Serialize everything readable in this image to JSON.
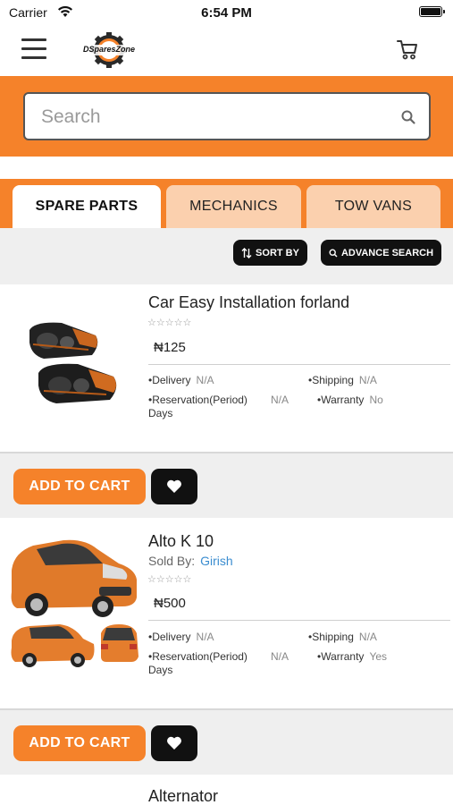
{
  "status_bar": {
    "carrier": "Carrier",
    "time": "6:54 PM"
  },
  "header": {
    "logo_text": "DSparesZone"
  },
  "search": {
    "placeholder": "Search"
  },
  "tabs": [
    {
      "label": "SPARE PARTS",
      "active": true
    },
    {
      "label": "MECHANICS",
      "active": false
    },
    {
      "label": "TOW VANS",
      "active": false
    }
  ],
  "toolbar": {
    "sort_label": "SORT BY",
    "advance_label": "ADVANCE SEARCH"
  },
  "products": [
    {
      "title": "Car Easy Installation forland",
      "sold_by_label": "",
      "seller": "",
      "rating_stars": "☆☆☆☆☆",
      "price": "₦125",
      "delivery_label": "•Delivery",
      "delivery_value": "N/A",
      "shipping_label": "•Shipping",
      "shipping_value": "N/A",
      "reservation_label": "•Reservation(Period)",
      "reservation_value": "N/A",
      "reservation_unit": "Days",
      "warranty_label": "•Warranty",
      "warranty_value": "No",
      "add_to_cart": "ADD TO CART"
    },
    {
      "title": "Alto K 10",
      "sold_by_label": "Sold By:",
      "seller": "Girish",
      "rating_stars": "☆☆☆☆☆",
      "price": "₦500",
      "delivery_label": "•Delivery",
      "delivery_value": "N/A",
      "shipping_label": "•Shipping",
      "shipping_value": "N/A",
      "reservation_label": "•Reservation(Period)",
      "reservation_value": "N/A",
      "reservation_unit": "Days",
      "warranty_label": "•Warranty",
      "warranty_value": "Yes",
      "add_to_cart": "ADD TO CART"
    },
    {
      "title": "Alternator"
    }
  ],
  "colors": {
    "accent": "#f5822a",
    "tab_inactive": "#fbd0ae",
    "link": "#3b8dd0",
    "dark": "#111111"
  }
}
